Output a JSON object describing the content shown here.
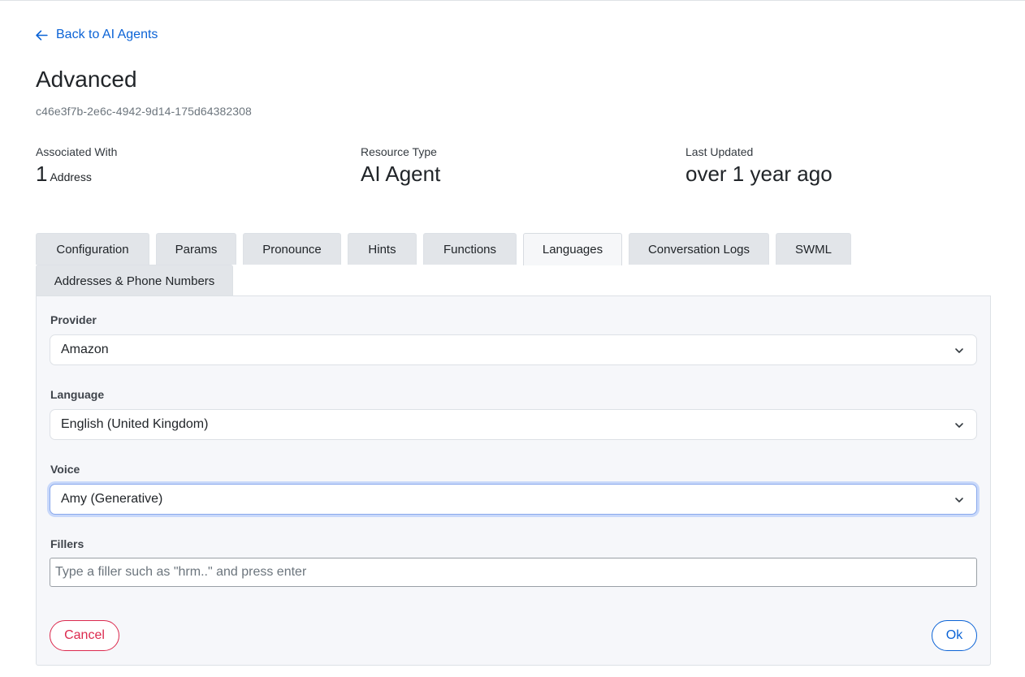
{
  "back_link": {
    "label": "Back to AI Agents"
  },
  "page": {
    "title": "Advanced",
    "id": "c46e3f7b-2e6c-4942-9d14-175d64382308"
  },
  "stats": {
    "associated": {
      "label": "Associated With",
      "count": "1",
      "unit": "Address"
    },
    "resource_type": {
      "label": "Resource Type",
      "value": "AI Agent"
    },
    "last_updated": {
      "label": "Last Updated",
      "value": "over 1 year ago"
    }
  },
  "tabs": [
    {
      "label": "Configuration"
    },
    {
      "label": "Params"
    },
    {
      "label": "Pronounce"
    },
    {
      "label": "Hints"
    },
    {
      "label": "Functions"
    },
    {
      "label": "Languages",
      "active": true
    },
    {
      "label": "Conversation Logs"
    },
    {
      "label": "SWML"
    },
    {
      "label": "Addresses & Phone Numbers"
    }
  ],
  "form": {
    "provider": {
      "label": "Provider",
      "value": "Amazon"
    },
    "language": {
      "label": "Language",
      "value": "English (United Kingdom)"
    },
    "voice": {
      "label": "Voice",
      "value": "Amy (Generative)"
    },
    "fillers": {
      "label": "Fillers",
      "placeholder": "Type a filler such as \"hrm..\" and press enter"
    },
    "cancel_label": "Cancel",
    "ok_label": "Ok"
  },
  "colors": {
    "link": "#0b63d6",
    "danger": "#dc2a4e",
    "tab_bg": "#e2e5e9",
    "panel_bg": "#f6f7fa",
    "focus_ring": "#c8d8fa"
  },
  "icons": {
    "back": "arrow-left-icon",
    "select_caret": "chevron-down-icon"
  }
}
